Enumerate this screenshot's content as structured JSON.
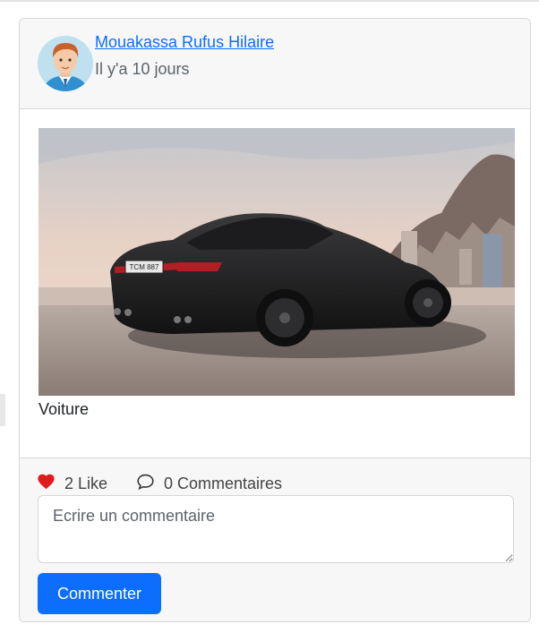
{
  "post": {
    "author": "Mouakassa Rufus Hilaire",
    "time": "Il y'a 10 jours",
    "caption": "Voiture",
    "car_plate": "TCM 887"
  },
  "footer": {
    "likes_label": "2 Like",
    "comments_label": "0 Commentaires",
    "comment_placeholder": "Ecrire un commentaire",
    "submit_label": "Commenter"
  },
  "icons": {
    "like": "heart-icon",
    "comment": "speech-bubble-icon",
    "avatar": "user-avatar"
  },
  "colors": {
    "accent": "#0d6efd",
    "heart": "#e01b1b",
    "muted": "#5c636a"
  }
}
